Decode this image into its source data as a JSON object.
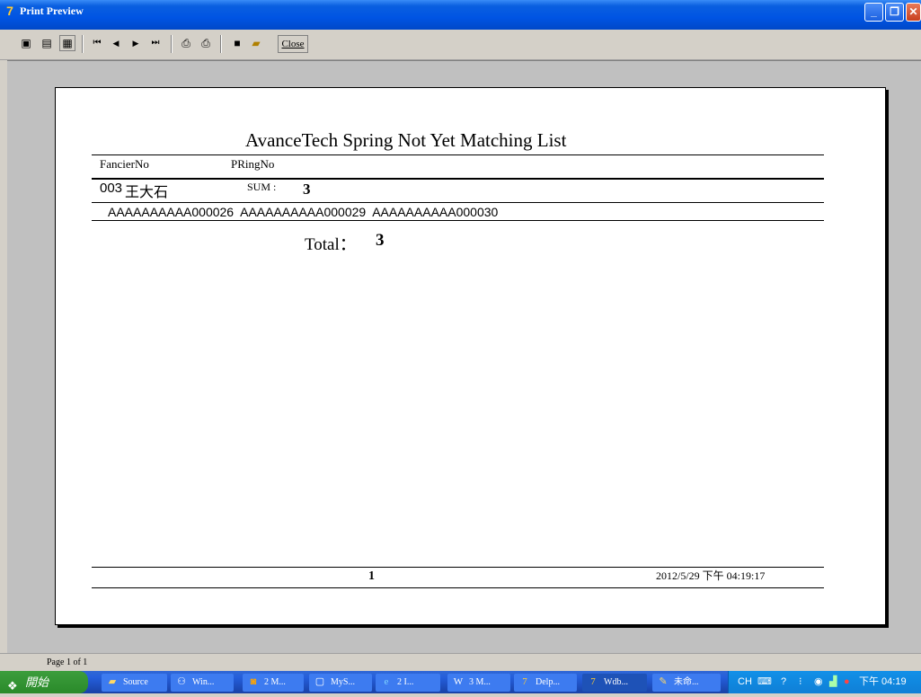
{
  "window": {
    "title": "Print Preview"
  },
  "toolbar": {
    "icons": [
      "whole-page-icon",
      "page-width-icon",
      "zoom-100-icon",
      "first-page-icon",
      "prev-page-icon",
      "next-page-icon",
      "last-page-icon",
      "print-setup-icon",
      "print-icon",
      "save-icon",
      "open-icon"
    ],
    "close_label": "Close"
  },
  "report": {
    "title": "AvanceTech Spring Not Yet Matching List",
    "col_fancier": "FancierNo",
    "col_pring": "PRingNo",
    "group_id": "003",
    "group_name": "王大石",
    "sum_label": "SUM :",
    "sum_value": "3",
    "rings": "AAAAAAAAAA000026  AAAAAAAAAA000029  AAAAAAAAAA000030",
    "total_label": "Total：",
    "total_value": "3",
    "page_number": "1",
    "timestamp": "2012/5/29 下午 04:19:17"
  },
  "status": {
    "page_info": "Page 1 of 1"
  },
  "taskbar": {
    "start_label": "開始",
    "tasks": [
      {
        "label": "Source",
        "icon": "folder-icon"
      },
      {
        "label": "Win...",
        "icon": "network-icon"
      },
      {
        "label": "2 M...",
        "icon": "outlook-icon"
      },
      {
        "label": "MyS...",
        "icon": "window-icon"
      },
      {
        "label": "2 I...",
        "icon": "ie-icon"
      },
      {
        "label": "3 M...",
        "icon": "word-icon"
      },
      {
        "label": "Delp...",
        "icon": "delphi-icon"
      },
      {
        "label": "Wdb...",
        "icon": "delphi-icon"
      },
      {
        "label": "未命...",
        "icon": "paint-icon"
      }
    ],
    "tray": {
      "lang": "CH",
      "clock": "下午 04:19"
    }
  }
}
